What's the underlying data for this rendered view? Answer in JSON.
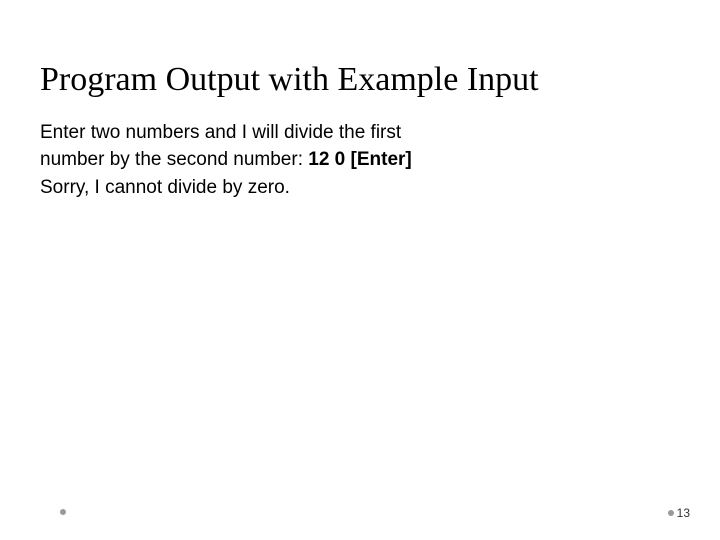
{
  "slide": {
    "title": "Program Output with Example Input",
    "body": {
      "line1": "Enter two numbers and I will divide the first",
      "line2_prefix": "number by the second number: ",
      "line2_bold": "12 0 [Enter]",
      "line3": "Sorry, I cannot divide by zero."
    },
    "page_number": "13"
  }
}
